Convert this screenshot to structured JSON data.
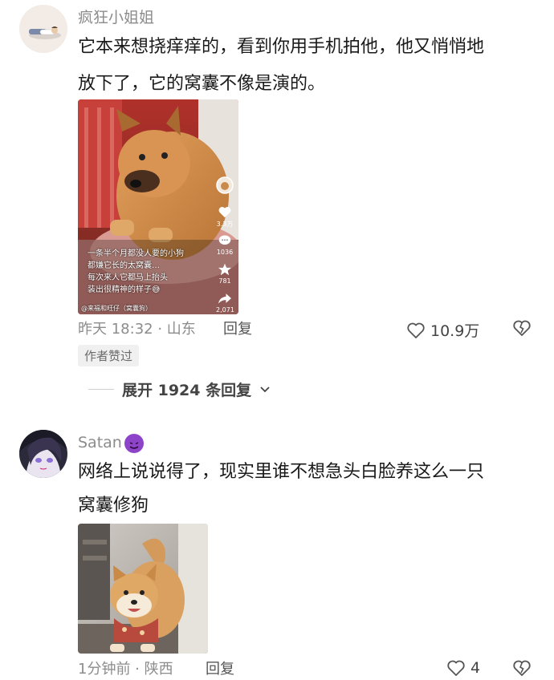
{
  "comments": [
    {
      "username": "疯狂小姐姐",
      "text_line1": "它本来想挠痒痒的，看到你用手机拍他，他又悄悄地",
      "text_line2": "放下了，它的窝囊不像是演的。",
      "video_overlay": {
        "line1": "一条半个月都没人要的小狗",
        "line2": "都嫌它长的太窝囊…",
        "line3": "每次来人它都马上抬头",
        "line4": "装出很精神的样子😅",
        "bottom_caption": "@来福和旺仔（窝囊狗）",
        "likes": "3.3万",
        "comments_count": "1036",
        "favorites": "781",
        "shares": "2,071"
      },
      "time": "昨天 18:32",
      "location": "山东",
      "reply_label": "回复",
      "likes": "10.9万",
      "badge": "作者赞过",
      "expand_label": "展开 1924 条回复"
    },
    {
      "username": "Satan",
      "text_line1": "网络上说说得了，现实里谁不想急头白脸养这么一只",
      "text_line2": "窝囊修狗",
      "time": "1分钟前",
      "location": "陕西",
      "reply_label": "回复",
      "likes": "4"
    }
  ],
  "icons": {
    "like": "heart-outline-icon",
    "dislike": "broken-heart-icon",
    "expand": "chevron-down-icon",
    "devil_emoji": "smiling-devil-icon"
  },
  "colors": {
    "meta": "#8c8c8c",
    "text": "#1a1a1a",
    "devil": "#8e44c9"
  }
}
